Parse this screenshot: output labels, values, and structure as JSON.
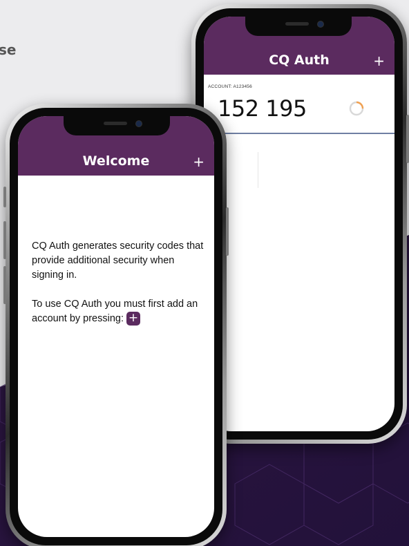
{
  "background": {
    "cut_word": "se",
    "accent": "#2c1540"
  },
  "back_phone": {
    "header": {
      "title": "CQ Auth",
      "add_label": "+"
    },
    "account": {
      "label": "ACCOUNT: A123456",
      "code": "152 195",
      "timer_icon": "countdown-ring-icon",
      "timer_remaining": 0.25
    }
  },
  "front_phone": {
    "header": {
      "title": "Welcome",
      "add_label": "+"
    },
    "body": {
      "paragraph1": "CQ Auth generates security codes that provide additional security when signing in.",
      "paragraph2": "To use CQ Auth you must first add an account by pressing:",
      "inline_button_label": "+"
    }
  },
  "colors": {
    "header": "#5b2b5f",
    "divider": "#6f7fa3",
    "timer": "#f0a050"
  }
}
